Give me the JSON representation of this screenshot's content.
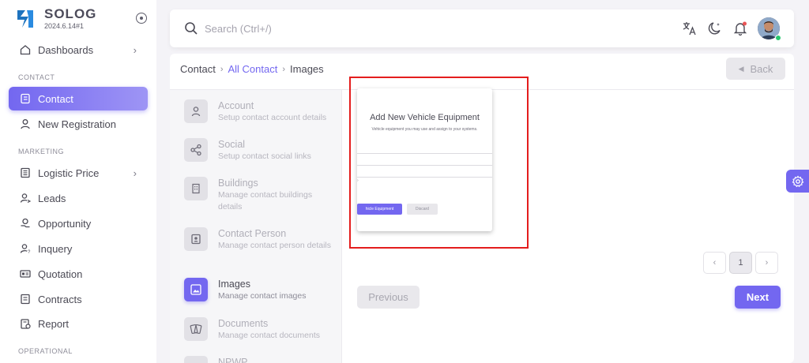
{
  "brand": {
    "name": "SOLOG",
    "version": "2024.6.14#1"
  },
  "sidebar": {
    "dashboards": "Dashboards",
    "section_contact": "CONTACT",
    "contact": "Contact",
    "new_registration": "New Registration",
    "section_marketing": "MARKETING",
    "logistic_price": "Logistic Price",
    "leads": "Leads",
    "opportunity": "Opportunity",
    "inquery": "Inquery",
    "quotation": "Quotation",
    "contracts": "Contracts",
    "report": "Report",
    "section_operational": "OPERATIONAL"
  },
  "search": {
    "placeholder": "Search (Ctrl+/)"
  },
  "breadcrumb": {
    "root": "Contact",
    "link": "All Contact",
    "current": "Images"
  },
  "back_label": "Back",
  "steps": [
    {
      "title": "Account",
      "desc": "Setup contact account details"
    },
    {
      "title": "Social",
      "desc": "Setup contact social links"
    },
    {
      "title": "Buildings",
      "desc": "Manage contact buildings details"
    },
    {
      "title": "Contact Person",
      "desc": "Manage contact person details"
    },
    {
      "title": "Images",
      "desc": "Manage contact images"
    },
    {
      "title": "Documents",
      "desc": "Manage contact documents"
    },
    {
      "title": "NPWP",
      "desc": ""
    }
  ],
  "preview": {
    "title": "Add New Vehicle Equipment",
    "subtitle": "Vehicle equipment you may use and assign to your systems.",
    "primary_btn": "hicle Equipment",
    "secondary_btn": "Discard"
  },
  "pagination": {
    "prev": "‹",
    "current": "1",
    "next": "›"
  },
  "buttons": {
    "previous": "Previous",
    "next": "Next"
  },
  "colors": {
    "primary": "#7367f0",
    "highlight": "#e41d1d"
  }
}
